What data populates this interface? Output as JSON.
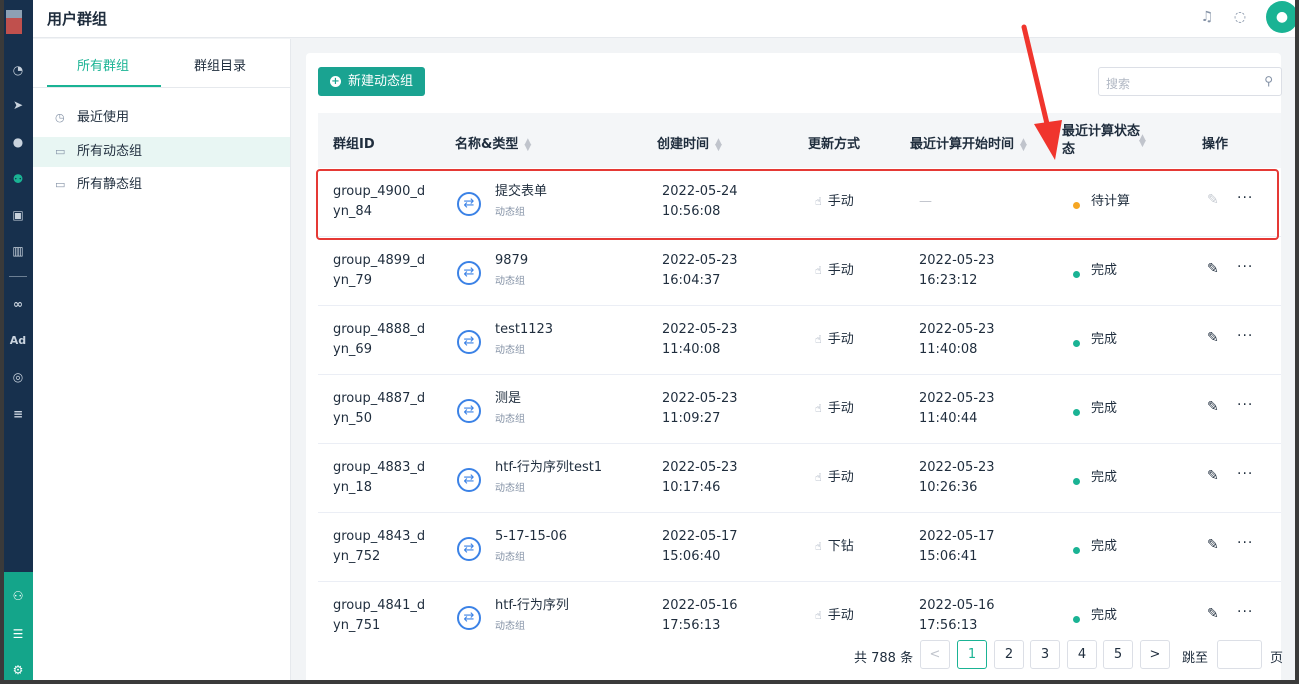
{
  "header": {
    "title": "用户群组",
    "bell_icon": "bell-icon",
    "chat_icon": "chat-icon",
    "avatar_icon": "user-icon"
  },
  "nav": {
    "icons": [
      "dashboard-icon",
      "send-icon",
      "user-icon",
      "users-icon",
      "bookmark-user-icon",
      "bar-chart-icon",
      "wechat-icon",
      "ad-icon",
      "target-icon",
      "list-icon",
      "team-icon",
      "server-icon",
      "settings-icon"
    ],
    "ad_label": "Ad"
  },
  "sidebar": {
    "tabs": [
      {
        "label": "所有群组"
      },
      {
        "label": "群组目录"
      }
    ],
    "items": [
      {
        "label": "最近使用",
        "icon": "clock-icon"
      },
      {
        "label": "所有动态组",
        "icon": "folder-icon"
      },
      {
        "label": "所有静态组",
        "icon": "folder-icon"
      }
    ]
  },
  "toolbar": {
    "new_label": "新建动态组",
    "search_placeholder": "搜索"
  },
  "table": {
    "headers": [
      "群组ID",
      "名称&类型",
      "创建时间",
      "更新方式",
      "最近计算开始时间",
      "最近计算状态",
      "态",
      "操作"
    ],
    "rows": [
      {
        "id1": "group_4900_d",
        "id2": "yn_84",
        "name": "提交表单",
        "type": "动态组",
        "c1": "2022-05-24",
        "c2": "10:56:08",
        "update": "手动",
        "s1": "—",
        "s2": "",
        "status": "待计算",
        "status_color": "#f5a623"
      },
      {
        "id1": "group_4899_d",
        "id2": "yn_79",
        "name": "9879",
        "type": "动态组",
        "c1": "2022-05-23",
        "c2": "16:04:37",
        "update": "手动",
        "s1": "2022-05-23",
        "s2": "16:23:12",
        "status": "完成",
        "status_color": "#1ab394"
      },
      {
        "id1": "group_4888_d",
        "id2": "yn_69",
        "name": "test1123",
        "type": "动态组",
        "c1": "2022-05-23",
        "c2": "11:40:08",
        "update": "手动",
        "s1": "2022-05-23",
        "s2": "11:40:08",
        "status": "完成",
        "status_color": "#1ab394"
      },
      {
        "id1": "group_4887_d",
        "id2": "yn_50",
        "name": "测是",
        "type": "动态组",
        "c1": "2022-05-23",
        "c2": "11:09:27",
        "update": "手动",
        "s1": "2022-05-23",
        "s2": "11:40:44",
        "status": "完成",
        "status_color": "#1ab394"
      },
      {
        "id1": "group_4883_d",
        "id2": "yn_18",
        "name": "htf-行为序列test1",
        "type": "动态组",
        "c1": "2022-05-23",
        "c2": "10:17:46",
        "update": "手动",
        "s1": "2022-05-23",
        "s2": "10:26:36",
        "status": "完成",
        "status_color": "#1ab394"
      },
      {
        "id1": "group_4843_d",
        "id2": "yn_752",
        "name": "5-17-15-06",
        "type": "动态组",
        "c1": "2022-05-17",
        "c2": "15:06:40",
        "update": "下钻",
        "s1": "2022-05-17",
        "s2": "15:06:41",
        "status": "完成",
        "status_color": "#1ab394"
      },
      {
        "id1": "group_4841_d",
        "id2": "yn_751",
        "name": "htf-行为序列",
        "type": "动态组",
        "c1": "2022-05-16",
        "c2": "17:56:13",
        "update": "手动",
        "s1": "2022-05-16",
        "s2": "17:56:13",
        "status": "完成",
        "status_color": "#1ab394"
      }
    ]
  },
  "pagination": {
    "total": "共 788 条",
    "pages": [
      "1",
      "2",
      "3",
      "4",
      "5"
    ],
    "current": "1",
    "jump_label": "跳至",
    "page_unit": "页",
    "prev": "<",
    "next": ">"
  }
}
